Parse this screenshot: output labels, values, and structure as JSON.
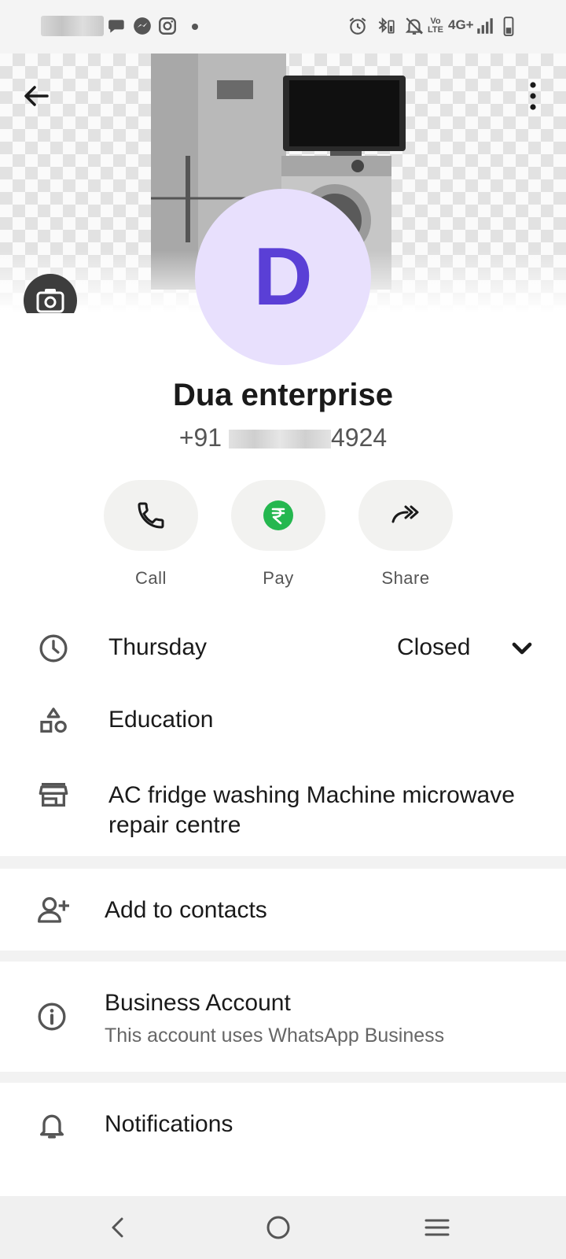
{
  "status_bar": {
    "network": "4G+",
    "volte": "Vo LTE"
  },
  "profile": {
    "avatar_letter": "D",
    "name": "Dua enterprise",
    "phone_prefix": "+91",
    "phone_suffix": "4924"
  },
  "actions": [
    {
      "label": "Call",
      "icon": "phone-icon"
    },
    {
      "label": "Pay",
      "icon": "rupee-icon",
      "color": "#25b74f"
    },
    {
      "label": "Share",
      "icon": "share-icon"
    }
  ],
  "business_info": {
    "hours_day": "Thursday",
    "hours_status": "Closed",
    "category": "Education",
    "description": "AC fridge washing Machine microwave repair centre"
  },
  "add_contact": {
    "label": "Add to contacts"
  },
  "business_account": {
    "title": "Business Account",
    "subtitle": "This account uses WhatsApp Business"
  },
  "notifications": {
    "label": "Notifications"
  },
  "colors": {
    "avatar_bg": "#e8e0fd",
    "avatar_text": "#5a3fd6",
    "pay_green": "#25b74f"
  }
}
